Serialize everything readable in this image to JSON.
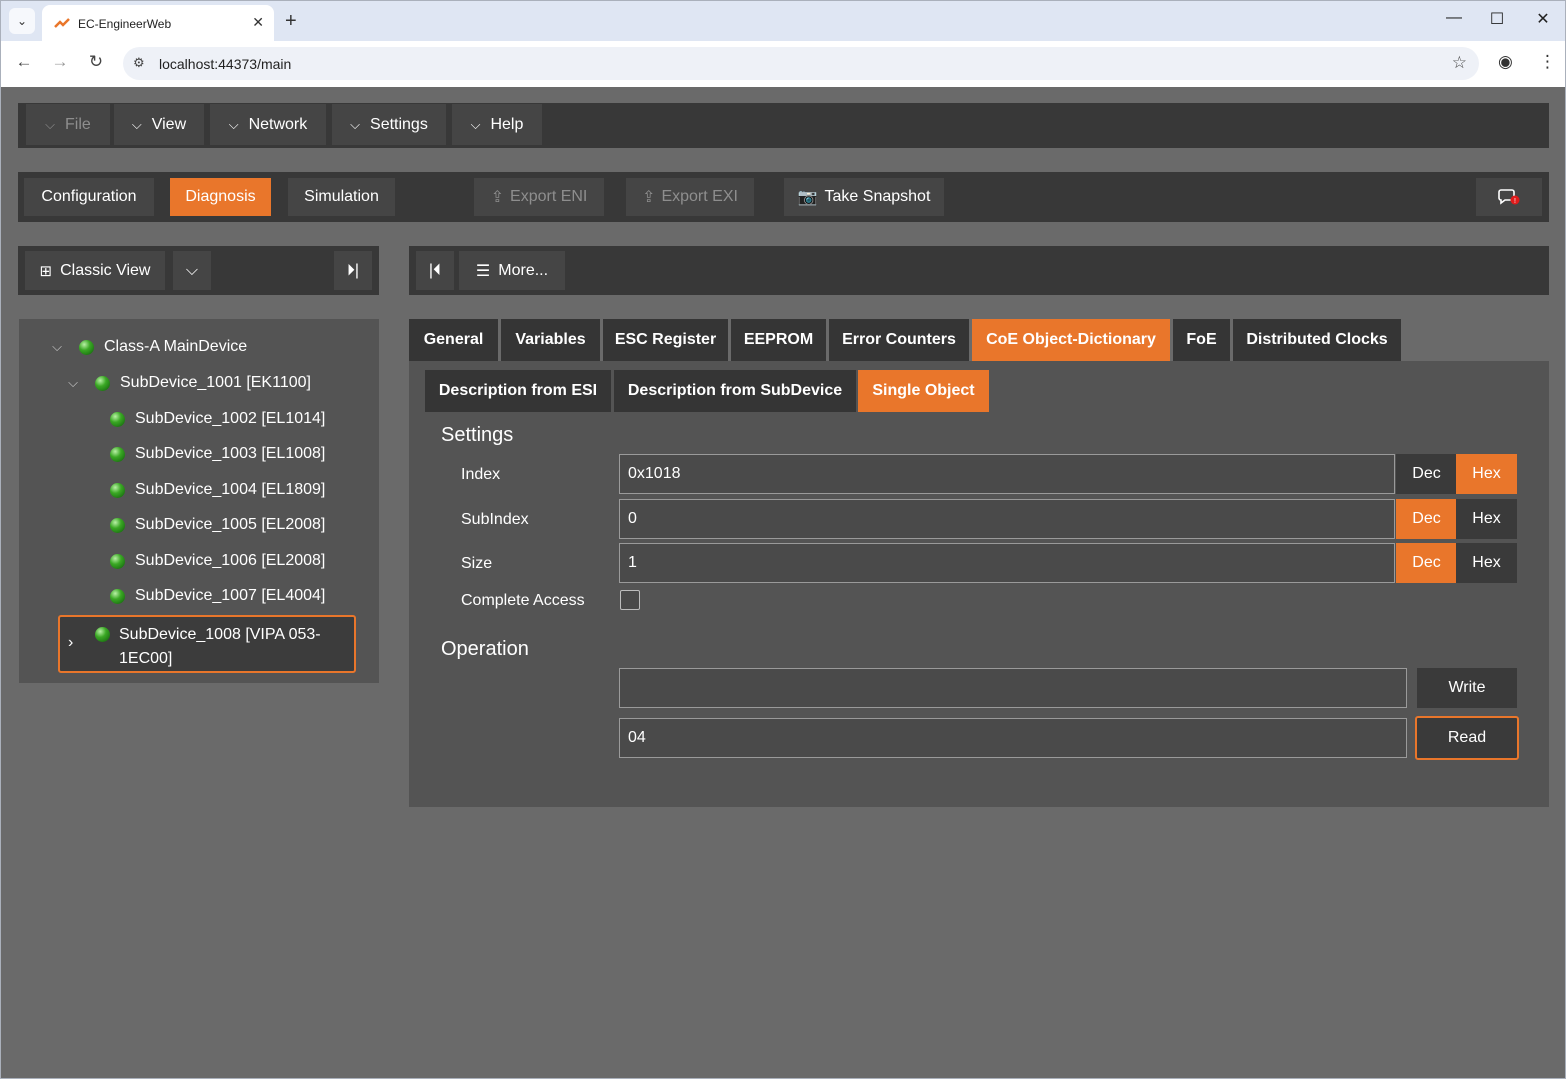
{
  "browser": {
    "tab_title": "EC-EngineerWeb",
    "url": "localhost:44373/main",
    "new_tab": "+",
    "close_tab": "✕",
    "min": "—",
    "max": "☐",
    "close": "✕"
  },
  "menubar": {
    "file": "File",
    "view": "View",
    "network": "Network",
    "settings": "Settings",
    "help": "Help"
  },
  "modebar": {
    "configuration": "Configuration",
    "diagnosis": "Diagnosis",
    "simulation": "Simulation",
    "export_eni": "Export ENI",
    "export_exi": "Export EXI",
    "take_snapshot": "Take Snapshot"
  },
  "left_toolbar": {
    "classic_view": "Classic View"
  },
  "right_toolbar": {
    "more": "More..."
  },
  "tree": {
    "root": "Class-A MainDevice",
    "parent": "SubDevice_1001 [EK1100]",
    "children": [
      "SubDevice_1002 [EL1014]",
      "SubDevice_1003 [EL1008]",
      "SubDevice_1004 [EL1809]",
      "SubDevice_1005 [EL2008]",
      "SubDevice_1006 [EL2008]",
      "SubDevice_1007 [EL4004]"
    ],
    "selected_line1": "SubDevice_1008 [VIPA 053-",
    "selected_line2": "1EC00]"
  },
  "tabs": [
    "General",
    "Variables",
    "ESC Register",
    "EEPROM",
    "Error Counters",
    "CoE Object-Dictionary",
    "FoE",
    "Distributed Clocks"
  ],
  "active_tab": "CoE Object-Dictionary",
  "subtabs": [
    "Description from ESI",
    "Description from SubDevice",
    "Single Object"
  ],
  "active_subtab": "Single Object",
  "settings": {
    "title": "Settings",
    "index_label": "Index",
    "index_value": "0x1018",
    "index_mode": "Hex",
    "subindex_label": "SubIndex",
    "subindex_value": "0",
    "subindex_mode": "Dec",
    "size_label": "Size",
    "size_value": "1",
    "size_mode": "Dec",
    "complete_access_label": "Complete Access",
    "complete_access_checked": false,
    "dec": "Dec",
    "hex": "Hex"
  },
  "operation": {
    "title": "Operation",
    "write_value": "",
    "write_label": "Write",
    "read_value": "04",
    "read_label": "Read"
  },
  "colors": {
    "accent": "#e9762b",
    "bar": "#383838",
    "panel": "#545454",
    "background": "#6a6a6a"
  }
}
